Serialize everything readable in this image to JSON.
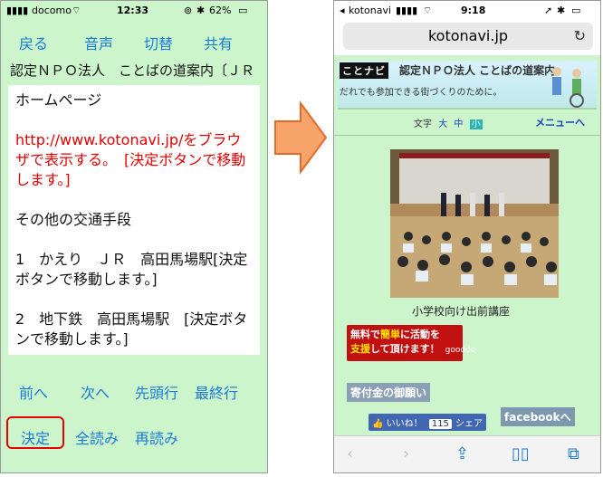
{
  "left_phone": {
    "status": {
      "carrier": "docomo",
      "time": "12:33",
      "battery": "62%"
    },
    "toolbar": {
      "back": "戻る",
      "voice": "音声",
      "switch": "切替",
      "share": "共有"
    },
    "title_line": "認定ＮＰＯ法人　ことばの道案内〔ＪＲ",
    "content": {
      "p1": "ホームページ",
      "p2_red": "http://www.kotonavi.jp/をブラウザで表示する。　[決定ボタンで移動します。]",
      "p3": "その他の交通手段",
      "p4": "1　かえり　ＪＲ　高田馬場駅[決定ボタンで移動します。]",
      "p5": "2　地下鉄　高田馬場駅　[決定ボタンで移動します。]"
    },
    "nav": {
      "prev": "前へ",
      "next": "次へ",
      "first": "先頭行",
      "last": "最終行"
    },
    "actions": {
      "decide": "決定",
      "read_all": "全読み",
      "reread": "再読み"
    }
  },
  "right_phone": {
    "status": {
      "app": "kotonavi",
      "time": "9:18"
    },
    "url": "kotonavi.jp",
    "banner": {
      "logo": "ことナビ",
      "title": "認定ＮＰＯ法人 ことばの道案内",
      "subtitle": "だれでも参加できる街づくりのために。"
    },
    "text_size": {
      "label": "文字",
      "large": "大",
      "medium": "中",
      "small": "小"
    },
    "menu": "メニューへ",
    "photo_caption": "小学校向け出前講座",
    "donate_banner": {
      "line1_a": "無料",
      "line1_b": "で",
      "line1_c": "簡単",
      "line1_d": "に活動を",
      "line2_a": "支援",
      "line2_b": "して頂けます！",
      "brand": "gooddo"
    },
    "donation_heading": "寄付金の御願い",
    "like": {
      "label": "いいね！",
      "count": "115"
    },
    "share": "シェア",
    "facebook": "facebookへ"
  },
  "colors": {
    "page_bg": "#ccf5cc",
    "link_blue": "#1a7ad4",
    "red_text": "#e30000",
    "arrow": "#f7a46a"
  }
}
